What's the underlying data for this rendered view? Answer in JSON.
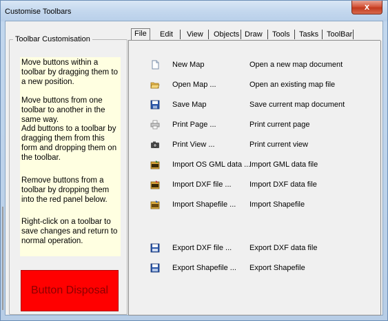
{
  "window": {
    "title": "Customise Toolbars",
    "close_glyph": "x"
  },
  "group": {
    "label": "Toolbar Customisation",
    "instructions": [
      "Move buttons within a toolbar by dragging them to a new position.",
      "Move buttons from one toolbar to another in the same way.",
      "Add buttons to a toolbar by dragging them from this form and dropping them on the toolbar.",
      "Remove buttons from a toolbar by dropping them into the red panel below.",
      "Right-click on a toolbar to save changes and return to normal operation."
    ],
    "disposal_label": "Button Disposal"
  },
  "tabs": [
    {
      "label": "File",
      "active": true
    },
    {
      "label": "Edit",
      "active": false
    },
    {
      "label": "View",
      "active": false
    },
    {
      "label": "Objects",
      "active": false
    },
    {
      "label": "Draw",
      "active": false
    },
    {
      "label": "Tools",
      "active": false
    },
    {
      "label": "Tasks",
      "active": false
    },
    {
      "label": "ToolBar",
      "active": false
    }
  ],
  "buttons": [
    {
      "name": "New Map",
      "description": "Open a new map document",
      "icon": "new-document-icon"
    },
    {
      "name": "Open Map ...",
      "description": "Open an existing map file",
      "icon": "open-folder-icon"
    },
    {
      "name": "Save Map",
      "description": "Save current map document",
      "icon": "save-disk-icon"
    },
    {
      "name": "Print Page ...",
      "description": "Print current page",
      "icon": "printer-icon"
    },
    {
      "name": "Print View ...",
      "description": "Print current view",
      "icon": "camera-icon"
    },
    {
      "name": "Import OS GML data ...",
      "description": "Import GML data file",
      "icon": "import-gml-icon"
    },
    {
      "name": "Import DXF file ...",
      "description": "Import DXF data file",
      "icon": "import-dxf-icon"
    },
    {
      "name": "Import Shapefile ...",
      "description": "Import Shapefile",
      "icon": "import-shp-icon"
    },
    {
      "name": "Export DXF file ...",
      "description": "Export DXF data file",
      "icon": "export-dxf-icon"
    },
    {
      "name": "Export Shapefile ...",
      "description": "Export Shapefile",
      "icon": "export-shp-icon"
    }
  ]
}
